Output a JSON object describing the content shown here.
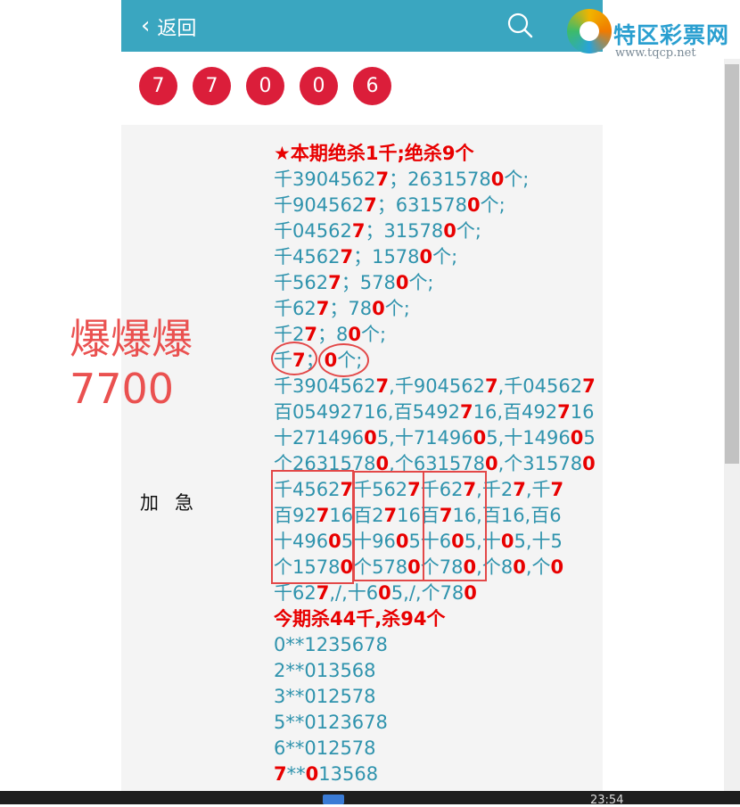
{
  "header": {
    "back_label": "返回"
  },
  "logo": {
    "title": "特区彩票网",
    "url": "www.tqcp.net"
  },
  "balls": [
    "7",
    "7",
    "0",
    "0",
    "6"
  ],
  "overlay": {
    "line1": "爆爆爆",
    "line2": "7700"
  },
  "side_label": "加急",
  "heading1": "★本期绝杀1千;绝杀9个",
  "lines1": [
    [
      {
        "t": "千390456 2"
      }
    ],
    [
      {
        "t": ""
      }
    ]
  ],
  "content": [
    [
      {
        "t": "★本期绝杀1千;绝杀9个",
        "h": 1
      }
    ],
    [
      {
        "t": "千3904562"
      },
      {
        "t": "7",
        "r": 1
      },
      {
        "t": "；263157 8"
      },
      {
        "t": "0",
        "r": 1
      },
      {
        "t": "个;"
      }
    ],
    [
      {
        "t": "千904562"
      },
      {
        "t": "7",
        "r": 1
      },
      {
        "t": "；631578"
      },
      {
        "t": "0",
        "r": 1
      },
      {
        "t": "个;"
      }
    ],
    [
      {
        "t": "千04562"
      },
      {
        "t": "7",
        "r": 1
      },
      {
        "t": "；31578"
      },
      {
        "t": "0",
        "r": 1
      },
      {
        "t": "个;"
      }
    ],
    [
      {
        "t": "千4562"
      },
      {
        "t": "7",
        "r": 1
      },
      {
        "t": "；1578"
      },
      {
        "t": "0",
        "r": 1
      },
      {
        "t": "个;"
      }
    ],
    [
      {
        "t": "千562"
      },
      {
        "t": "7",
        "r": 1
      },
      {
        "t": "；578"
      },
      {
        "t": "0",
        "r": 1
      },
      {
        "t": "个;"
      }
    ],
    [
      {
        "t": "千62"
      },
      {
        "t": "7",
        "r": 1
      },
      {
        "t": "；78"
      },
      {
        "t": "0",
        "r": 1
      },
      {
        "t": "个;"
      }
    ],
    [
      {
        "t": "千2"
      },
      {
        "t": "7",
        "r": 1
      },
      {
        "t": "；8"
      },
      {
        "t": "0",
        "r": 1
      },
      {
        "t": "个;"
      }
    ],
    [
      {
        "t": "千"
      },
      {
        "t": "7",
        "r": 1
      },
      {
        "t": "；"
      },
      {
        "t": "0",
        "r": 1
      },
      {
        "t": "个;"
      }
    ],
    [
      {
        "t": "千3904562"
      },
      {
        "t": "7",
        "r": 1
      },
      {
        "t": ",千904562"
      },
      {
        "t": "7",
        "r": 1
      },
      {
        "t": ",千04562"
      },
      {
        "t": "7",
        "r": 1
      }
    ],
    [
      {
        "t": "百054927"
      },
      {
        "t": "16,百5492"
      },
      {
        "t": "7",
        "r": 1
      },
      {
        "t": "16,百492"
      },
      {
        "t": "7",
        "r": 1
      },
      {
        "t": "16"
      }
    ],
    [
      {
        "t": "十271496"
      },
      {
        "t": "0",
        "r": 1
      },
      {
        "t": "5,十71496"
      },
      {
        "t": "0",
        "r": 1
      },
      {
        "t": "5,十1496"
      },
      {
        "t": "0",
        "r": 1
      },
      {
        "t": "5"
      }
    ],
    [
      {
        "t": "个2631578"
      },
      {
        "t": "0",
        "r": 1
      },
      {
        "t": ",个631578"
      },
      {
        "t": "0",
        "r": 1
      },
      {
        "t": ",个31578"
      },
      {
        "t": "0",
        "r": 1
      }
    ],
    [
      {
        "t": "千4562"
      },
      {
        "t": "7",
        "r": 1
      },
      {
        "t": "千562"
      },
      {
        "t": "7",
        "r": 1
      },
      {
        "t": "千62"
      },
      {
        "t": "7",
        "r": 1
      },
      {
        "t": ",千2"
      },
      {
        "t": "7",
        "r": 1
      },
      {
        "t": ",千"
      },
      {
        "t": "7",
        "r": 1
      }
    ],
    [
      {
        "t": "百92"
      },
      {
        "t": "7",
        "r": 1
      },
      {
        "t": "16百2"
      },
      {
        "t": "7",
        "r": 1
      },
      {
        "t": "16百"
      },
      {
        "t": "7",
        "r": 1
      },
      {
        "t": "16,百16,百6"
      }
    ],
    [
      {
        "t": "十496"
      },
      {
        "t": "0",
        "r": 1
      },
      {
        "t": "5十96"
      },
      {
        "t": "0",
        "r": 1
      },
      {
        "t": "5十6"
      },
      {
        "t": "0",
        "r": 1
      },
      {
        "t": "5,十"
      },
      {
        "t": "0",
        "r": 1
      },
      {
        "t": "5,十5"
      }
    ],
    [
      {
        "t": "个1578"
      },
      {
        "t": "0",
        "r": 1
      },
      {
        "t": "个578"
      },
      {
        "t": "0",
        "r": 1
      },
      {
        "t": "个78"
      },
      {
        "t": "0",
        "r": 1
      },
      {
        "t": ",个8"
      },
      {
        "t": "0",
        "r": 1
      },
      {
        "t": ",个"
      },
      {
        "t": "0",
        "r": 1
      }
    ],
    [
      {
        "t": "千62"
      },
      {
        "t": "7",
        "r": 1
      },
      {
        "t": ",/,十6"
      },
      {
        "t": "0",
        "r": 1
      },
      {
        "t": "5,/,个78"
      },
      {
        "t": "0",
        "r": 1
      }
    ],
    [
      {
        "t": "今期杀44千,杀94个",
        "h": 1
      }
    ],
    [
      {
        "t": "0**1235678"
      }
    ],
    [
      {
        "t": "2**013568"
      }
    ],
    [
      {
        "t": "3**012578"
      }
    ],
    [
      {
        "t": "5**0123678"
      }
    ],
    [
      {
        "t": "6**012578"
      }
    ],
    [
      {
        "t": "7",
        "r": 1
      },
      {
        "t": "**"
      },
      {
        "t": "0",
        "r": 1
      },
      {
        "t": "13568"
      }
    ]
  ],
  "taskbar": {
    "clock": "23:54"
  }
}
